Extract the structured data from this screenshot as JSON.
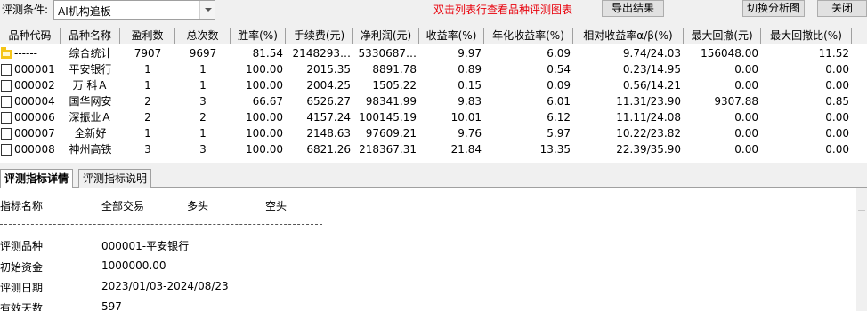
{
  "toolbar": {
    "condition_label": "评测条件:",
    "condition_value": "AI机构追板",
    "hint": "双击列表行查看品种评测图表",
    "export_label": "导出结果",
    "switch_label": "切换分析图",
    "close_label": "关闭"
  },
  "grid": {
    "headers": [
      "品种代码",
      "品种名称",
      "盈利数",
      "总次数",
      "胜率(%)",
      "手续费(元)",
      "净利润(元)",
      "收益率(%)",
      "年化收益率(%)",
      "相对收益率α/β(%)",
      "最大回撤(元)",
      "最大回撤比(%)"
    ],
    "rows": [
      [
        "------",
        "综合统计",
        "7907",
        "9697",
        "81.54",
        "2148293…",
        "5330687…",
        "9.97",
        "6.09",
        "9.74/24.03",
        "156048.00",
        "11.52"
      ],
      [
        "000001",
        "平安银行",
        "1",
        "1",
        "100.00",
        "2015.35",
        "8891.78",
        "0.89",
        "0.54",
        "0.23/14.95",
        "0.00",
        "0.00"
      ],
      [
        "000002",
        "万  科Ａ",
        "1",
        "1",
        "100.00",
        "2004.25",
        "1505.22",
        "0.15",
        "0.09",
        "0.56/14.21",
        "0.00",
        "0.00"
      ],
      [
        "000004",
        "国华网安",
        "2",
        "3",
        "66.67",
        "6526.27",
        "98341.99",
        "9.83",
        "6.01",
        "11.31/23.90",
        "9307.88",
        "0.85"
      ],
      [
        "000006",
        "深振业Ａ",
        "2",
        "2",
        "100.00",
        "4157.24",
        "100145.19",
        "10.01",
        "6.12",
        "11.11/24.08",
        "0.00",
        "0.00"
      ],
      [
        "000007",
        "全新好",
        "1",
        "1",
        "100.00",
        "2148.63",
        "97609.21",
        "9.76",
        "5.97",
        "10.22/23.82",
        "0.00",
        "0.00"
      ],
      [
        "000008",
        "神州高铁",
        "3",
        "3",
        "100.00",
        "6821.26",
        "218367.31",
        "21.84",
        "13.35",
        "22.39/35.90",
        "0.00",
        "0.00"
      ]
    ]
  },
  "tabs": [
    "评测指标详情",
    "评测指标说明"
  ],
  "detail": {
    "header": {
      "name": "指标名称",
      "all": "全部交易",
      "long": "多头",
      "short": "空头"
    },
    "items": [
      {
        "label": "评测品种",
        "value": "000001-平安银行"
      },
      {
        "label": "初始资金",
        "value": "1000000.00"
      },
      {
        "label": "评测日期",
        "value": "2023/01/03-2024/08/23"
      },
      {
        "label": "有效天数",
        "value": "597"
      }
    ]
  }
}
